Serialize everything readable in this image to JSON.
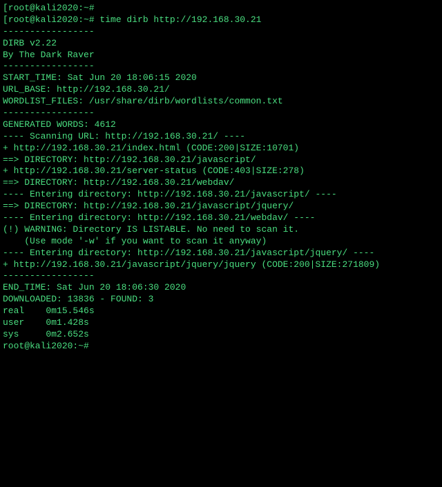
{
  "terminal": {
    "lines": [
      "[root@kali2020:~#",
      "[root@kali2020:~# time dirb http://192.168.30.21",
      "",
      "-----------------",
      "DIRB v2.22",
      "By The Dark Raver",
      "-----------------",
      "",
      "START_TIME: Sat Jun 20 18:06:15 2020",
      "URL_BASE: http://192.168.30.21/",
      "WORDLIST_FILES: /usr/share/dirb/wordlists/common.txt",
      "",
      "-----------------",
      "",
      "GENERATED WORDS: 4612",
      "",
      "---- Scanning URL: http://192.168.30.21/ ----",
      "+ http://192.168.30.21/index.html (CODE:200|SIZE:10701)",
      "==> DIRECTORY: http://192.168.30.21/javascript/",
      "+ http://192.168.30.21/server-status (CODE:403|SIZE:278)",
      "==> DIRECTORY: http://192.168.30.21/webdav/",
      "",
      "---- Entering directory: http://192.168.30.21/javascript/ ----",
      "==> DIRECTORY: http://192.168.30.21/javascript/jquery/",
      "",
      "---- Entering directory: http://192.168.30.21/webdav/ ----",
      "(!) WARNING: Directory IS LISTABLE. No need to scan it.",
      "    (Use mode '-w' if you want to scan it anyway)",
      "",
      "---- Entering directory: http://192.168.30.21/javascript/jquery/ ----",
      "+ http://192.168.30.21/javascript/jquery/jquery (CODE:200|SIZE:271809)",
      "",
      "-----------------",
      "END_TIME: Sat Jun 20 18:06:30 2020",
      "DOWNLOADED: 13836 - FOUND: 3",
      "",
      "real    0m15.546s",
      "user    0m1.428s",
      "sys     0m2.652s",
      "root@kali2020:~#"
    ]
  }
}
